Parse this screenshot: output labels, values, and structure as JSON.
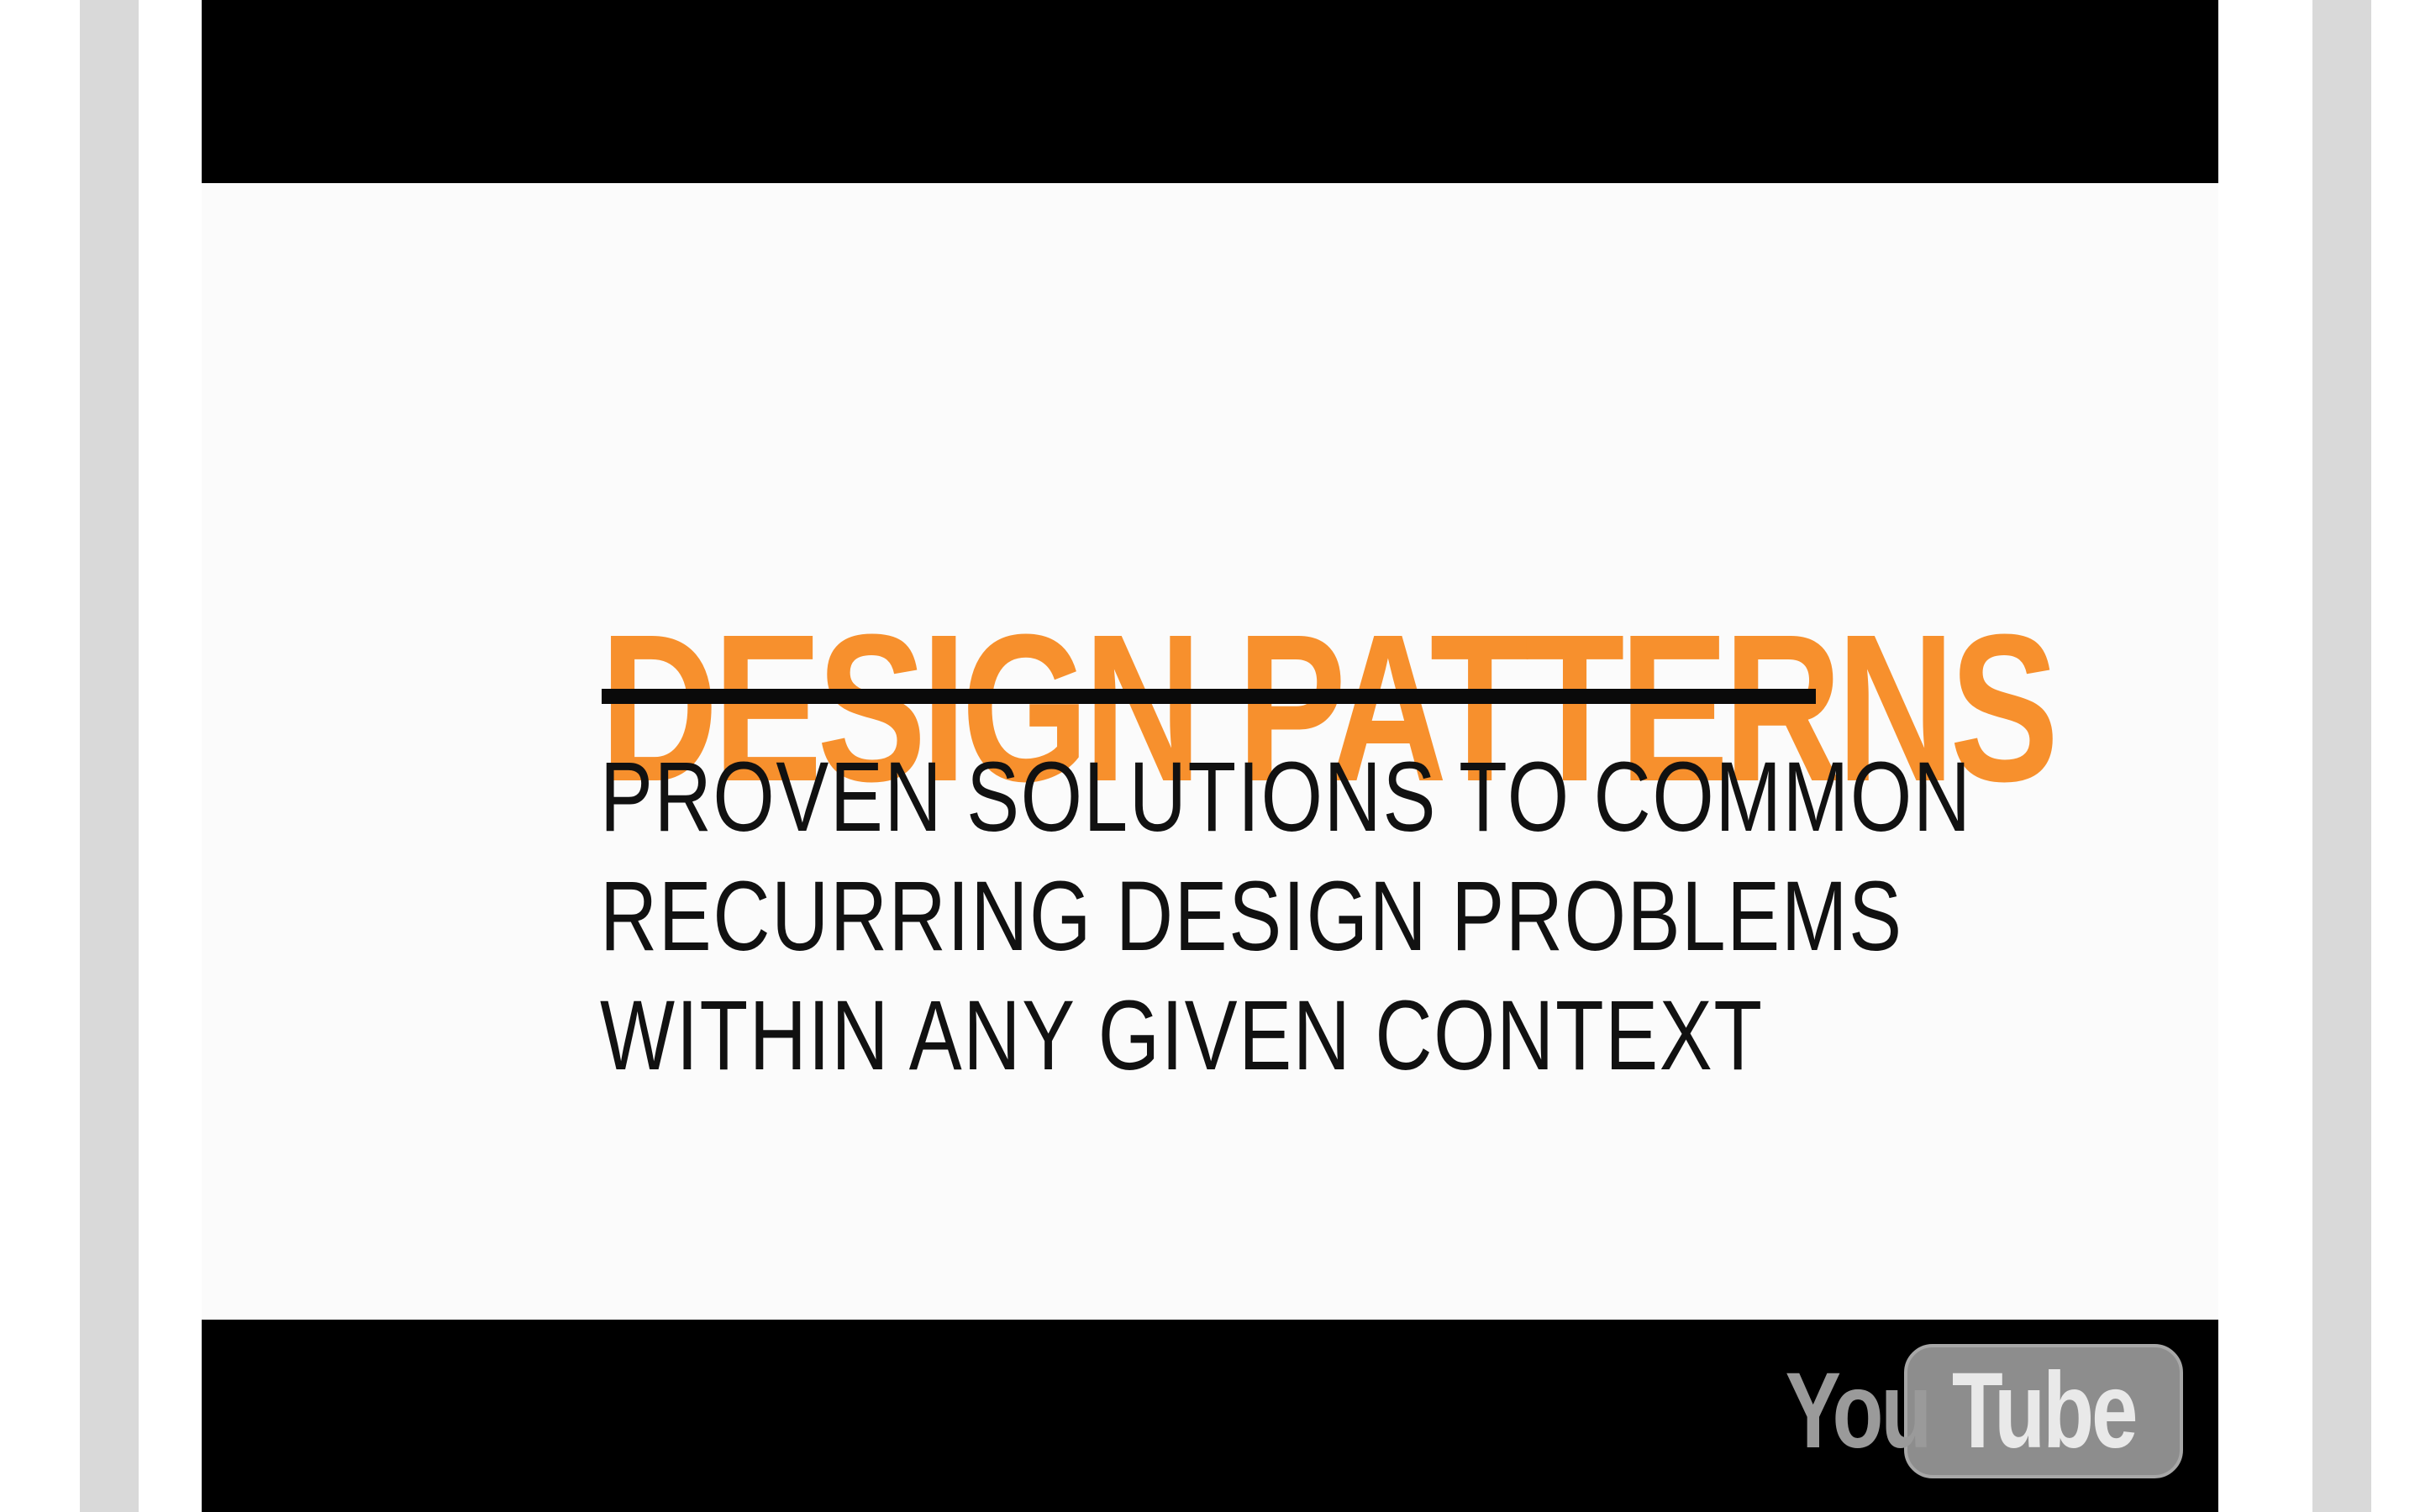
{
  "video": {
    "slide": {
      "title": "DESIGN PATTERNS",
      "lines": [
        "PROVEN SOLUTIONS TO COMMON",
        "RECURRING DESIGN PROBLEMS",
        "WITHIN ANY GIVEN CONTEXT"
      ]
    },
    "watermark": {
      "you": "You",
      "tube": "Tube"
    }
  },
  "colors": {
    "accent": "#f7902d",
    "letterbox": "#000000",
    "frame_background": "#fbfbfb",
    "side_bars": "#d9d9d9"
  }
}
